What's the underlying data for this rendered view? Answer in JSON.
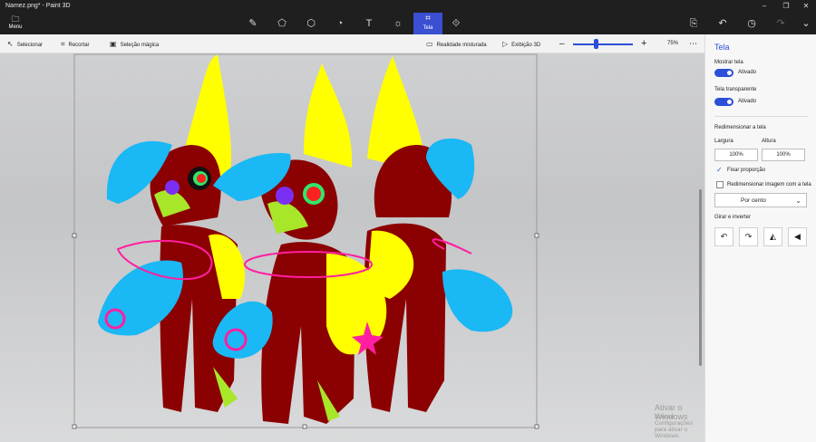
{
  "window": {
    "title": "Namez.png* - Paint 3D",
    "minimize_icon": "–",
    "maximize_icon": "❐",
    "close_icon": "✕"
  },
  "ribbon": {
    "menu_label": "Menu",
    "active_tool_label": "Tela"
  },
  "toolbar": {
    "select_label": "Selecionar",
    "crop_label": "Recortar",
    "magic_select_label": "Seleção mágica",
    "mixed_reality_label": "Realidade misturada",
    "view3d_label": "Exibição 3D",
    "zoom_value": "75%",
    "zoom_level": 0.6,
    "more_icon": "⋯"
  },
  "panel": {
    "title": "Tela",
    "show_canvas_label": "Mostrar tela",
    "show_canvas_state": "Ativado",
    "transparent_canvas_label": "Tela transparente",
    "transparent_canvas_state": "Ativado",
    "resize_heading": "Redimensionar a tela",
    "width_label": "Largura",
    "height_label": "Altura",
    "width_value": "100%",
    "height_value": "100%",
    "lock_ratio_label": "Fixar proporção",
    "resize_image_label": "Redimensionar imagem com a tela",
    "unit_select_value": "Por cento",
    "rotate_heading": "Girar e inverter"
  },
  "watermark": {
    "line1": "Ativar o Windows",
    "line2": "Acesse Configurações para ativar o Windows."
  },
  "colors": {
    "accent": "#3a4fd1",
    "dark_red": "#8b0000",
    "yellow": "#ffff00",
    "cyan": "#1ab8f5",
    "magenta": "#ff1fa0"
  }
}
